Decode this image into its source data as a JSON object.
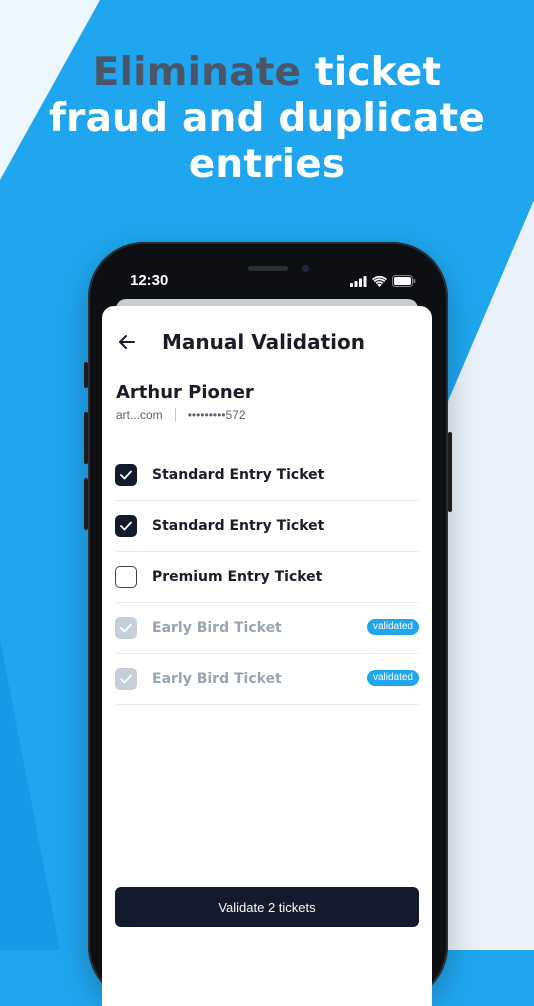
{
  "headline": {
    "highlight": "Eliminate",
    "rest_line1": " ticket",
    "line2": "fraud and duplicate",
    "line3": "entries"
  },
  "colors": {
    "background": "#1fa6ee",
    "headline_highlight": "#4a5568",
    "button_dark": "#131a2c",
    "badge": "#1fa6ee"
  },
  "status_bar": {
    "time": "12:30",
    "icons": [
      "signal-icon",
      "wifi-icon",
      "battery-icon"
    ]
  },
  "screen": {
    "title": "Manual Validation",
    "back_icon": "arrow-left-icon",
    "user": {
      "name": "Arthur Pioner",
      "email": "art...com",
      "phone": "•••••••••572"
    },
    "tickets": [
      {
        "label": "Standard Entry Ticket",
        "state": "checked",
        "badge": ""
      },
      {
        "label": "Standard Entry Ticket",
        "state": "checked",
        "badge": ""
      },
      {
        "label": "Premium Entry Ticket",
        "state": "unchecked",
        "badge": ""
      },
      {
        "label": "Early Bird Ticket",
        "state": "validated",
        "badge": "validated"
      },
      {
        "label": "Early Bird Ticket",
        "state": "validated",
        "badge": "validated"
      }
    ],
    "validate_button": "Validate 2 tickets"
  }
}
